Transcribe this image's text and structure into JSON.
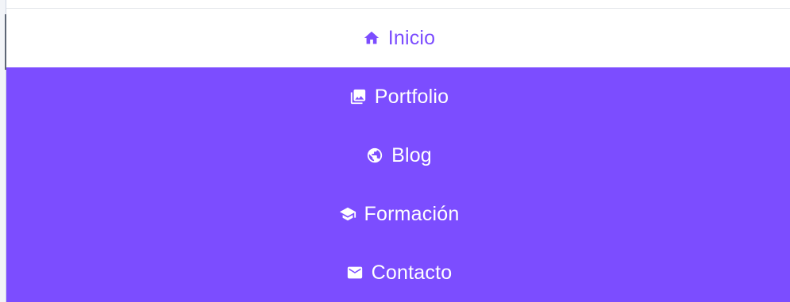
{
  "nav": {
    "items": [
      {
        "label": "Inicio",
        "icon": "home-icon",
        "active": true
      },
      {
        "label": "Portfolio",
        "icon": "photo-library-icon",
        "active": false
      },
      {
        "label": "Blog",
        "icon": "globe-icon",
        "active": false
      },
      {
        "label": "Formación",
        "icon": "graduation-cap-icon",
        "active": false
      },
      {
        "label": "Contacto",
        "icon": "mail-icon",
        "active": false
      }
    ]
  },
  "colors": {
    "accent": "#7c4dff",
    "active_bg": "#ffffff",
    "active_text": "#7c4dff",
    "inactive_text": "#ffffff"
  }
}
